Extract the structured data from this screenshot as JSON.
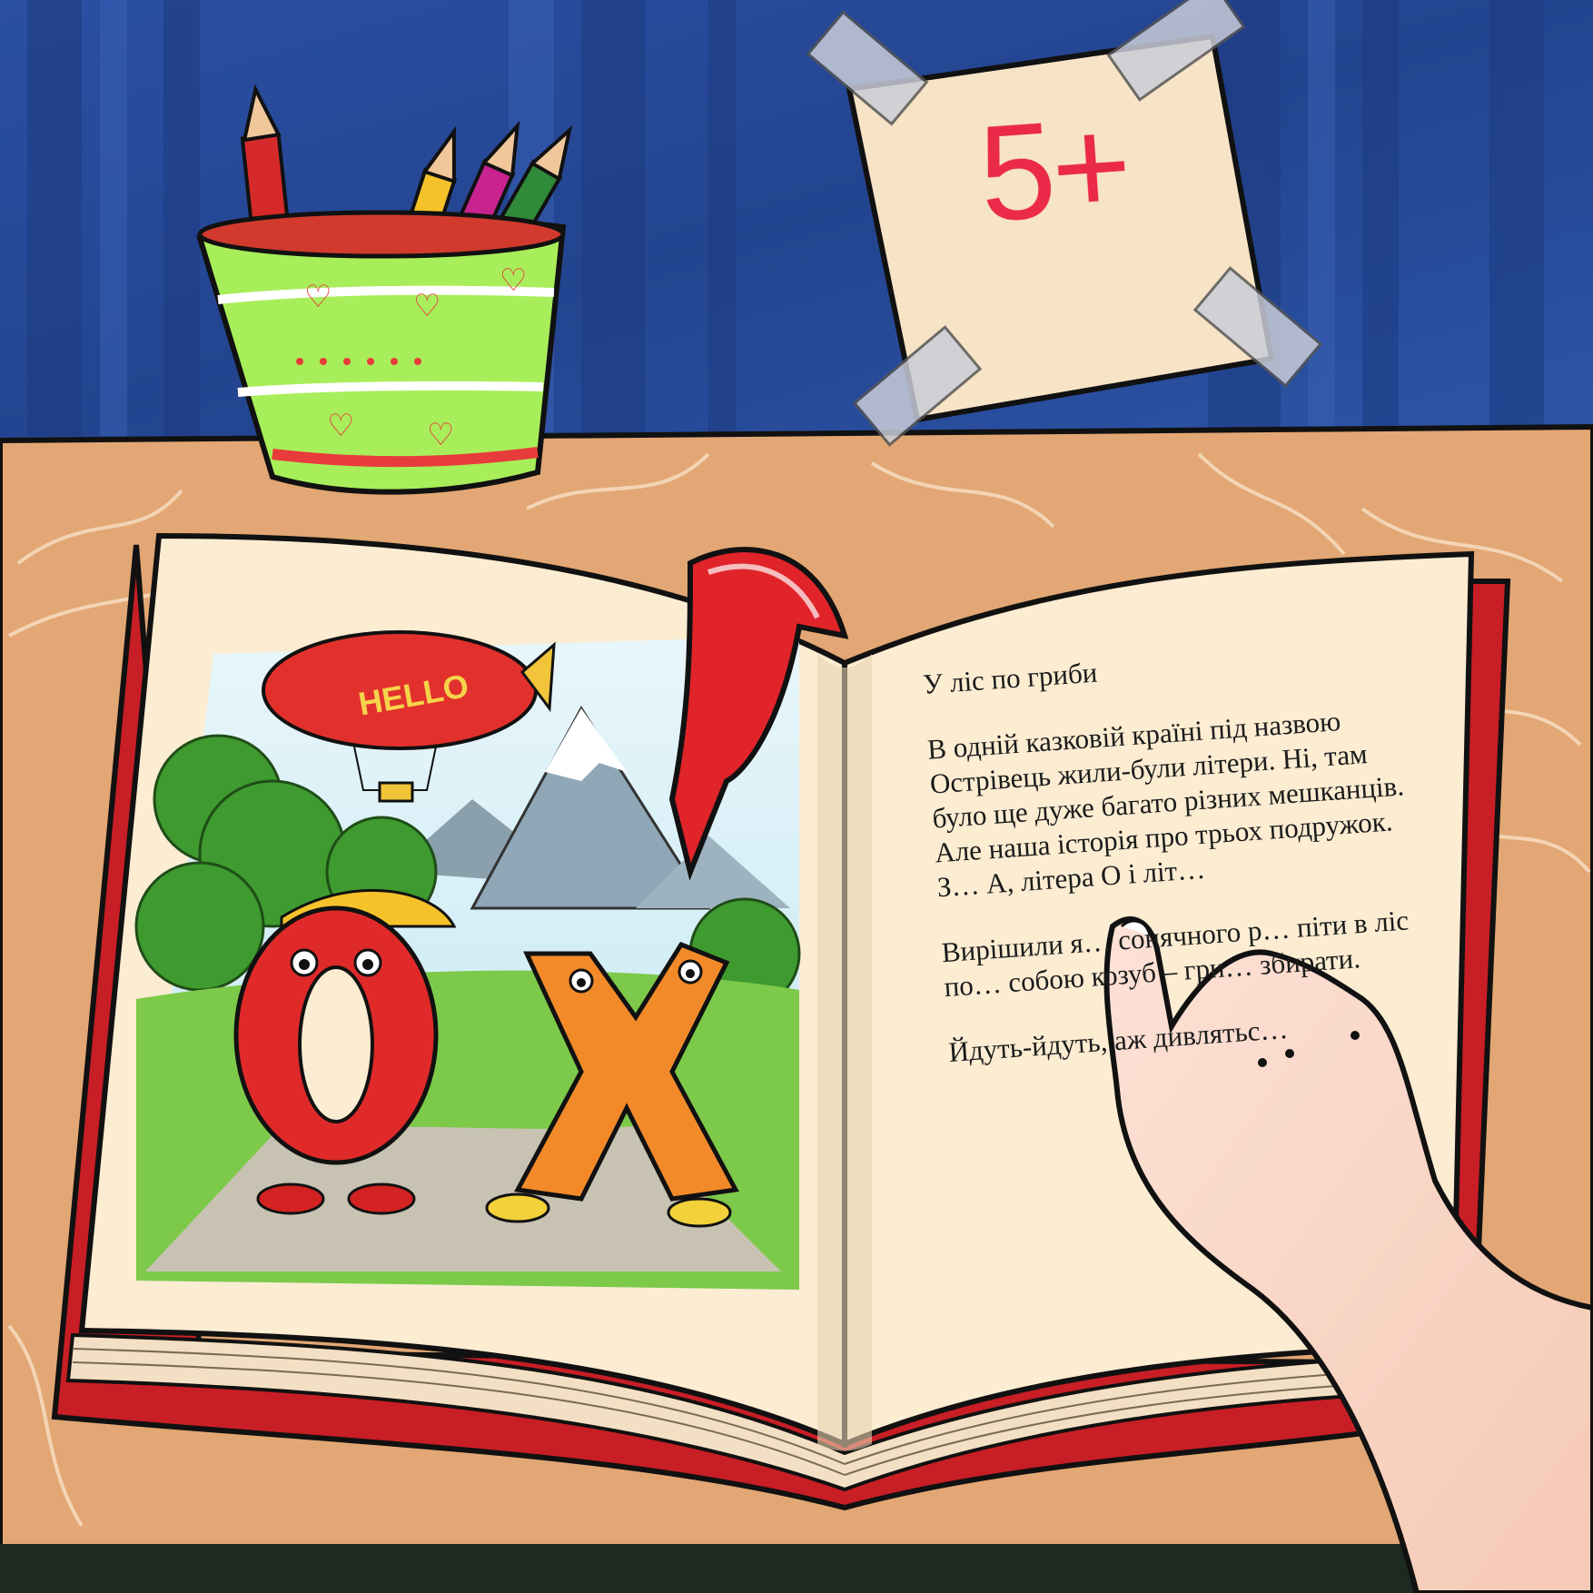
{
  "sticker": {
    "grade": "5+"
  },
  "blimp": {
    "label": "HELLO"
  },
  "illustration": {
    "letter_o": "O",
    "letter_x": "X"
  },
  "story": {
    "title": "У ліс по гриби",
    "paragraph1": "В одній казковій країні під назвою Острівець жили-були літери. Ні, там було ще дуже багато різних мешканців. Але наша історія про трьох подружок. З… А, літера О і літ…",
    "paragraph2": "Вирішили я… сонячного р… піти в ліс по… собою козуб – гри… збирати.",
    "paragraph3": "Йдуть-йдуть, аж дивлятьс…"
  },
  "colors": {
    "wall": "#2a4a9a",
    "desk": "#e2a774",
    "book_cover": "#c81e25",
    "page": "#fbecd2",
    "cup": "#a8ee5a",
    "sticker": "#f7e3c6",
    "grade_ink": "#ea2a48"
  }
}
